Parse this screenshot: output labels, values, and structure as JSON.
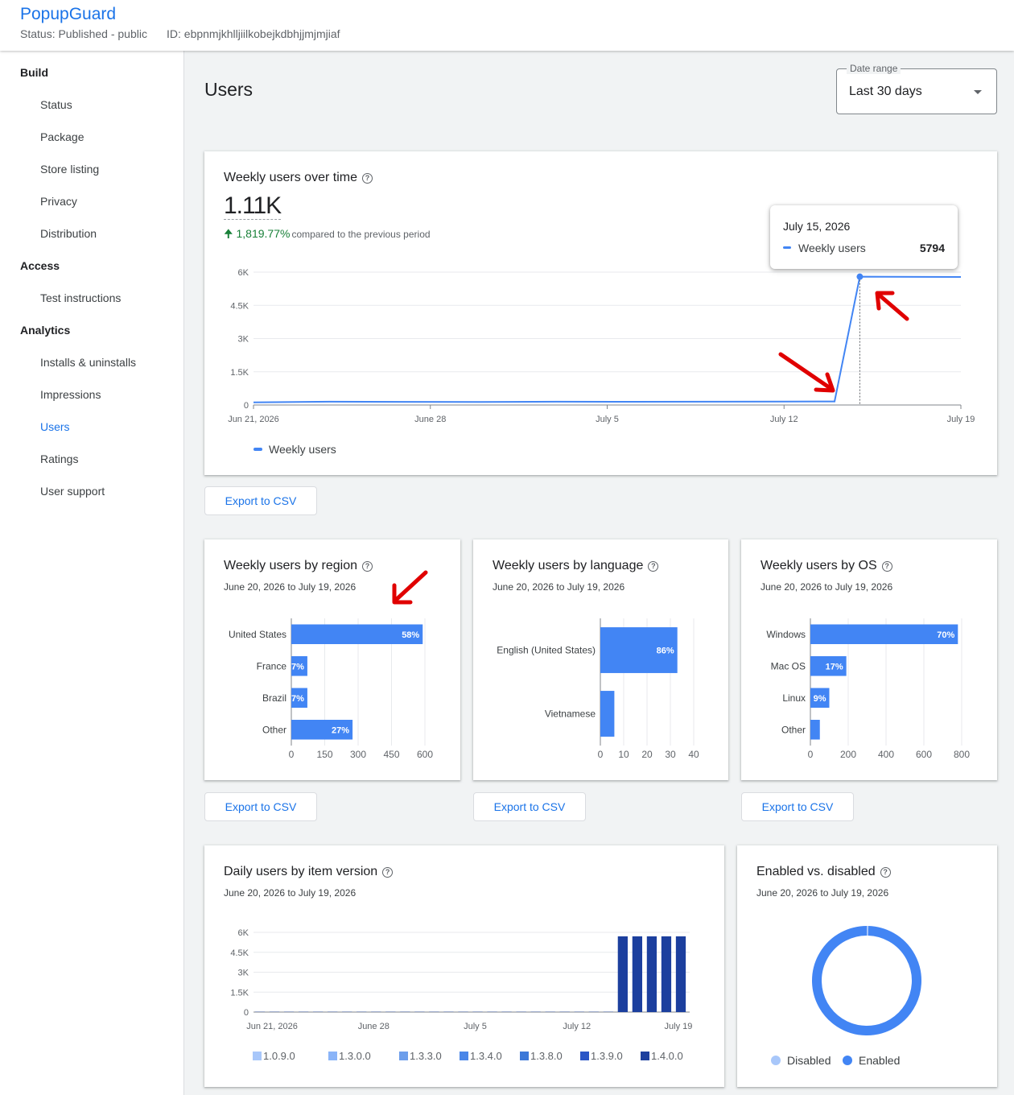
{
  "header": {
    "app_title": "PopupGuard",
    "status": "Status: Published - public",
    "id": "ID: ebpnmjkhlljiilkobejkdbhjjmjmjiaf"
  },
  "sidebar": {
    "sections": [
      {
        "label": "Build",
        "items": [
          "Status",
          "Package",
          "Store listing",
          "Privacy",
          "Distribution"
        ]
      },
      {
        "label": "Access",
        "items": [
          "Test instructions"
        ]
      },
      {
        "label": "Analytics",
        "items": [
          "Installs & uninstalls",
          "Impressions",
          "Users",
          "Ratings",
          "User support"
        ]
      }
    ],
    "active_item": "Users"
  },
  "page": {
    "title": "Users",
    "date_range": {
      "label": "Date range",
      "value": "Last 30 days"
    }
  },
  "weekly_card": {
    "title": "Weekly users over time",
    "total": "1.11K",
    "change": "1,819.77%",
    "change_note": "compared to the previous period",
    "tooltip": {
      "date": "July 15, 2026",
      "series": "Weekly users",
      "value": "5794"
    },
    "legend": "Weekly users",
    "export": "Export to CSV"
  },
  "region_card": {
    "title": "Weekly users by region",
    "range": "June 20, 2026 to July 19, 2026",
    "export": "Export to CSV"
  },
  "language_card": {
    "title": "Weekly users by language",
    "range": "June 20, 2026 to July 19, 2026",
    "export": "Export to CSV"
  },
  "os_card": {
    "title": "Weekly users by OS",
    "range": "June 20, 2026 to July 19, 2026",
    "export": "Export to CSV"
  },
  "version_card": {
    "title": "Daily users by item version",
    "range": "June 20, 2026 to July 19, 2026"
  },
  "enabled_card": {
    "title": "Enabled vs. disabled",
    "range": "June 20, 2026 to July 19, 2026"
  },
  "colors": {
    "accent": "#1a73e8",
    "series": "#4285f4",
    "positive": "#188038",
    "annotation": "#e00000"
  },
  "chart_data": [
    {
      "id": "weekly",
      "type": "line",
      "xlabel": "",
      "ylabel": "",
      "ylim": [
        0,
        6000
      ],
      "y_ticks": [
        "0",
        "1.5K",
        "3K",
        "4.5K",
        "6K"
      ],
      "y_tick_values": [
        0,
        1500,
        3000,
        4500,
        6000
      ],
      "x_ticks": [
        "Jun 21, 2026",
        "June 28",
        "July 5",
        "July 12",
        "July 19"
      ],
      "x_tick_days": [
        0,
        7,
        14,
        21,
        28
      ],
      "series": [
        {
          "name": "Weekly users",
          "x_days": [
            0,
            3,
            6,
            9,
            12,
            15,
            18,
            21,
            23,
            24,
            25,
            28
          ],
          "values": [
            120,
            150,
            140,
            135,
            150,
            145,
            150,
            155,
            160,
            5794,
            5790,
            5780
          ]
        }
      ],
      "highlight_day": 24,
      "grid": true,
      "legend_position": "bottom-left"
    },
    {
      "id": "region",
      "type": "bar",
      "categories": [
        "United States",
        "France",
        "Brazil",
        "Other"
      ],
      "values": [
        590,
        72,
        72,
        275
      ],
      "labels": [
        "58%",
        "7%",
        "7%",
        "27%"
      ],
      "xlim": [
        0,
        600
      ],
      "x_ticks": [
        0,
        150,
        300,
        450,
        600
      ]
    },
    {
      "id": "language",
      "type": "bar",
      "categories": [
        "English (United States)",
        "Vietnamese"
      ],
      "values": [
        33,
        6
      ],
      "labels": [
        "86%",
        ""
      ],
      "xlim": [
        0,
        40
      ],
      "x_ticks": [
        0,
        10,
        20,
        30,
        40
      ]
    },
    {
      "id": "os",
      "type": "bar",
      "categories": [
        "Windows",
        "Mac OS",
        "Linux",
        "Other"
      ],
      "values": [
        780,
        190,
        100,
        50
      ],
      "labels": [
        "70%",
        "17%",
        "9%",
        ""
      ],
      "xlim": [
        0,
        800
      ],
      "x_ticks": [
        0,
        200,
        400,
        600,
        800
      ]
    },
    {
      "id": "version",
      "type": "bar",
      "stacked": true,
      "ylim": [
        0,
        6000
      ],
      "y_ticks": [
        "0",
        "1.5K",
        "3K",
        "4.5K",
        "6K"
      ],
      "y_tick_values": [
        0,
        1500,
        3000,
        4500,
        6000
      ],
      "x_ticks": [
        "Jun 21, 2026",
        "June 28",
        "July 5",
        "July 12",
        "July 19"
      ],
      "x_tick_days": [
        0,
        7,
        14,
        21,
        28
      ],
      "legend": [
        {
          "name": "1.0.9.0",
          "color": "#a8c7fa"
        },
        {
          "name": "1.3.0.0",
          "color": "#8ab4f8"
        },
        {
          "name": "1.3.3.0",
          "color": "#6d9eeb"
        },
        {
          "name": "1.3.4.0",
          "color": "#4a86e8"
        },
        {
          "name": "1.3.8.0",
          "color": "#3c78d8"
        },
        {
          "name": "1.3.9.0",
          "color": "#2a56c6"
        },
        {
          "name": "1.4.0.0",
          "color": "#1c3f9e"
        }
      ],
      "days": [
        -1,
        0,
        1,
        2,
        3,
        4,
        5,
        6,
        7,
        8,
        9,
        10,
        11,
        12,
        13,
        14,
        15,
        16,
        17,
        18,
        19,
        20,
        21,
        22,
        23,
        24,
        25,
        26,
        27,
        28
      ],
      "values": [
        20,
        20,
        20,
        20,
        20,
        20,
        20,
        20,
        20,
        20,
        20,
        20,
        20,
        20,
        20,
        20,
        20,
        20,
        20,
        20,
        20,
        20,
        20,
        20,
        20,
        5700,
        5700,
        5700,
        5700,
        5700
      ],
      "dominant_version": "1.4.0.0"
    },
    {
      "id": "enabled",
      "type": "pie",
      "donut": true,
      "categories": [
        "Disabled",
        "Enabled"
      ],
      "values": [
        0.5,
        99.5
      ],
      "colors": [
        "#a8c7fa",
        "#4285f4"
      ]
    }
  ]
}
